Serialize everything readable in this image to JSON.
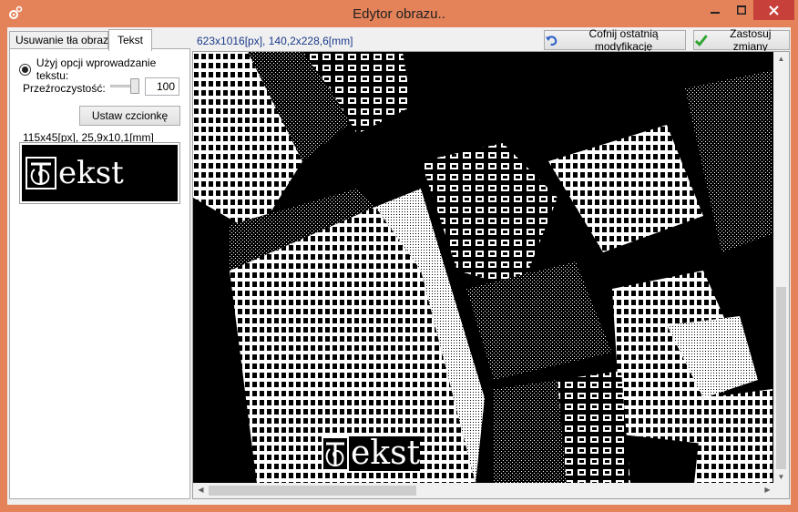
{
  "window": {
    "title": "Edytor obrazu..",
    "icon": "gear-tool-icon",
    "controls": [
      "minimize-icon",
      "maximize-icon",
      "close-icon"
    ]
  },
  "tabs": [
    {
      "label": "Usuwanie tła obrazu",
      "active": false
    },
    {
      "label": "Tekst",
      "active": true
    }
  ],
  "text_panel": {
    "radio_label": "Użyj opcji wprowadzanie tekstu:",
    "radio_selected": true,
    "opacity_label": "Przeźroczystość:",
    "opacity_value": "100",
    "font_button": "Ustaw czcionkę",
    "text_size": "115x45[px], 25,9x10,1[mm]",
    "preview_text": "ekst"
  },
  "toolbar": {
    "image_size": "623x1016[px], 140,2x228,6[mm]",
    "undo_label": "Cofnij ostatnią modyfikację",
    "undo_icon": "undo-arrow-icon",
    "apply_label": "Zastosuj zmiany",
    "apply_icon": "checkmark-icon"
  },
  "viewer": {
    "watermark_text": "ekst"
  },
  "colors": {
    "frame": "#e4835a",
    "close": "#c7403a",
    "size_text": "#1a3a8a"
  }
}
